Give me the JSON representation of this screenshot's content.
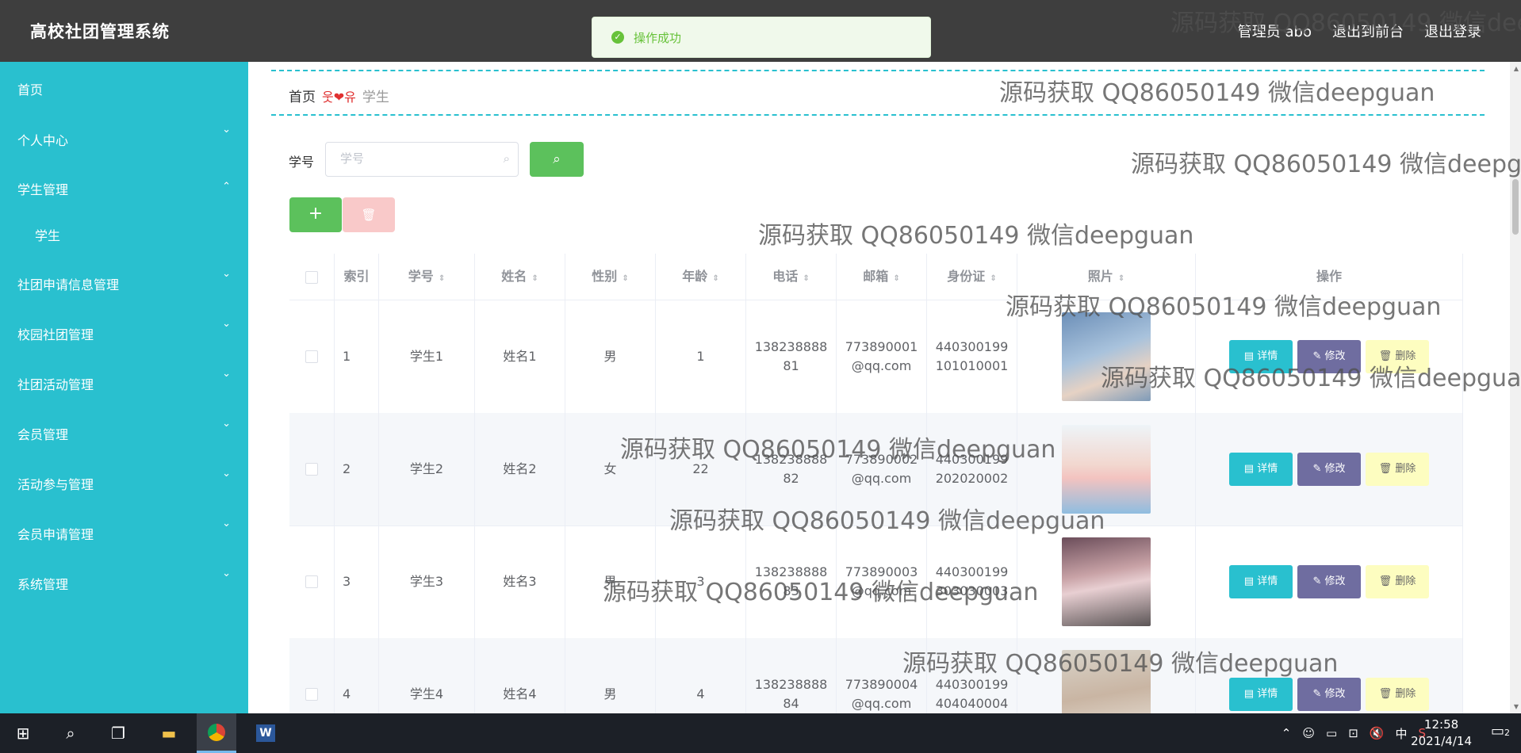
{
  "header": {
    "title": "高校社团管理系统",
    "user": "管理员 abo",
    "to_front": "退出到前台",
    "logout": "退出登录"
  },
  "toast": {
    "message": "操作成功"
  },
  "sidebar": {
    "items": [
      {
        "label": "首页",
        "chevron": ""
      },
      {
        "label": "个人中心",
        "chevron": "⌄"
      },
      {
        "label": "学生管理",
        "chevron": "⌃"
      },
      {
        "label": "学生",
        "chevron": ""
      },
      {
        "label": "社团申请信息管理",
        "chevron": "⌄"
      },
      {
        "label": "校园社团管理",
        "chevron": "⌄"
      },
      {
        "label": "社团活动管理",
        "chevron": "⌄"
      },
      {
        "label": "会员管理",
        "chevron": "⌄"
      },
      {
        "label": "活动参与管理",
        "chevron": "⌄"
      },
      {
        "label": "会员申请管理",
        "chevron": "⌄"
      },
      {
        "label": "系统管理",
        "chevron": "⌄"
      }
    ]
  },
  "breadcrumb": {
    "home": "首页",
    "separator": "웃❤유",
    "current": "学生"
  },
  "search": {
    "label": "学号",
    "placeholder": "学号",
    "value": ""
  },
  "toolbar": {
    "add_icon": "+",
    "delete_icon": "🗑"
  },
  "table": {
    "columns": [
      "索引",
      "学号",
      "姓名",
      "性别",
      "年龄",
      "电话",
      "邮箱",
      "身份证",
      "照片",
      "操作"
    ],
    "rows": [
      {
        "index": "1",
        "xuehao": "学生1",
        "name": "姓名1",
        "gender": "男",
        "age": "1",
        "phone_1": "138238888",
        "phone_2": "81",
        "email_1": "773890001",
        "email_2": "@qq.com",
        "id_1": "440300199",
        "id_2": "101010001",
        "photo_color": "#8aa3c4"
      },
      {
        "index": "2",
        "xuehao": "学生2",
        "name": "姓名2",
        "gender": "女",
        "age": "22",
        "phone_1": "138238888",
        "phone_2": "82",
        "email_1": "773890002",
        "email_2": "@qq.com",
        "id_1": "440300199",
        "id_2": "202020002",
        "photo_color": "#9fc6e3"
      },
      {
        "index": "3",
        "xuehao": "学生3",
        "name": "姓名3",
        "gender": "男",
        "age": "3",
        "phone_1": "138238888",
        "phone_2": "83",
        "email_1": "773890003",
        "email_2": "@qq.com",
        "id_1": "440300199",
        "id_2": "303030003",
        "photo_color": "#8f6f7d"
      },
      {
        "index": "4",
        "xuehao": "学生4",
        "name": "姓名4",
        "gender": "男",
        "age": "4",
        "phone_1": "138238888",
        "phone_2": "84",
        "email_1": "773890004",
        "email_2": "@qq.com",
        "id_1": "440300199",
        "id_2": "404040004",
        "photo_color": "#c9c2b5"
      }
    ],
    "actions": {
      "detail": "详情",
      "edit": "修改",
      "delete": "删除"
    }
  },
  "watermark": "源码获取 QQ86050149 微信deepguan",
  "taskbar": {
    "time": "12:58",
    "date": "2021/4/14",
    "ime": "中",
    "notifications": "2"
  },
  "colors": {
    "sidebar": "#29c0cf",
    "topbar": "#3e3e3e",
    "success": "#5cc15c",
    "edit": "#6f6da0"
  }
}
